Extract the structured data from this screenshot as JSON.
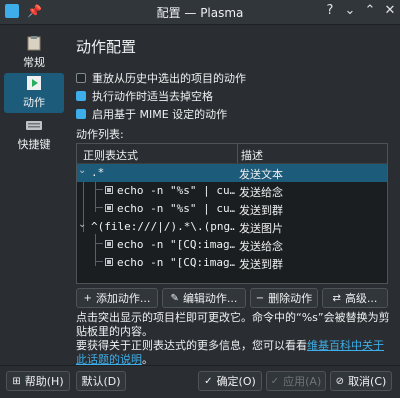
{
  "window": {
    "title": "配置 — Plasma",
    "help_glyph": "?",
    "min_glyph": "⌄",
    "max_glyph": "⌃",
    "close_glyph": "✕"
  },
  "sidebar": {
    "items": [
      {
        "label": "常规",
        "icon": "clipboard-icon"
      },
      {
        "label": "动作",
        "icon": "play-icon",
        "active": true
      },
      {
        "label": "快捷键",
        "icon": "keyboard-icon"
      }
    ]
  },
  "page": {
    "title": "动作配置",
    "options": [
      {
        "label": "重放从历史中选出的项目的动作",
        "checked": false
      },
      {
        "label": "执行动作时适当去掉空格",
        "checked": true
      },
      {
        "label": "启用基于 MIME 设定的动作",
        "checked": true
      }
    ],
    "action_list_label": "动作列表:"
  },
  "tree": {
    "col_regex": "正则表达式",
    "col_desc": "描述",
    "rows": [
      {
        "regex": ".*",
        "desc": "发送文本",
        "level": 0
      },
      {
        "regex": "echo -n \"%s\" | cu…",
        "desc": "发送给念",
        "level": 1
      },
      {
        "regex": "echo -n \"%s\" | cu…",
        "desc": "发送到群",
        "level": 1
      },
      {
        "regex": "^(file:///|/).*\\.(png…",
        "desc": "发送图片",
        "level": 0
      },
      {
        "regex": "echo -n \"[CQ:imag…",
        "desc": "发送给念",
        "level": 1
      },
      {
        "regex": "echo -n \"[CQ:imag…",
        "desc": "发送到群",
        "level": 1
      }
    ]
  },
  "buttons": {
    "add": "添加动作...",
    "edit": "编辑动作...",
    "delete": "删除动作",
    "advanced": "高级..."
  },
  "info": {
    "line1": "点击突出显示的项目栏即可更改它。命令中的“%s”会被替换为剪贴板里的内容。",
    "line2_prefix": "要获得关于正则表达式的更多信息，您可以看看",
    "link": "维基百科中关于此话题的说明",
    "line2_suffix": "。"
  },
  "footer": {
    "help": "帮助(H)",
    "defaults": "默认(D)",
    "ok": "确定(O)",
    "apply": "应用(A)",
    "cancel": "取消(C)"
  },
  "colors": {
    "accent": "#3daee9",
    "selection": "#1d5b7b",
    "background": "#2a2e32"
  }
}
